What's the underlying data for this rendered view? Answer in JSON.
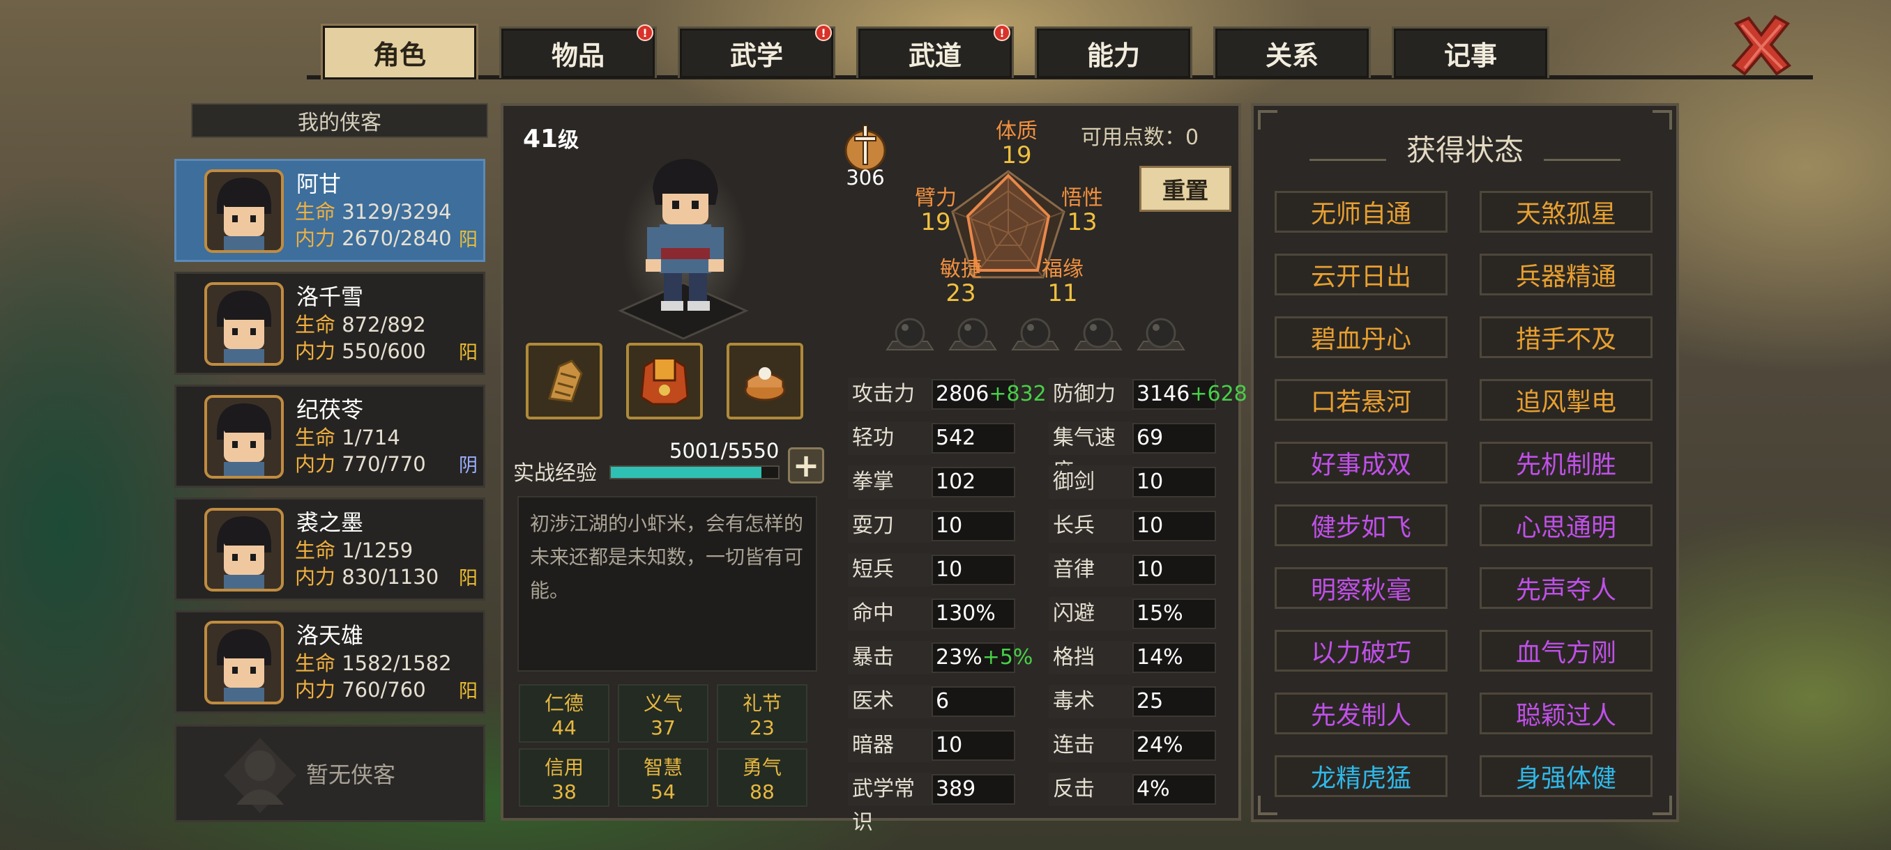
{
  "tabs": [
    {
      "label": "角色",
      "active": true,
      "badge": false
    },
    {
      "label": "物品",
      "active": false,
      "badge": true
    },
    {
      "label": "武学",
      "active": false,
      "badge": true
    },
    {
      "label": "武道",
      "active": false,
      "badge": true
    },
    {
      "label": "能力",
      "active": false,
      "badge": false
    },
    {
      "label": "关系",
      "active": false,
      "badge": false
    },
    {
      "label": "记事",
      "active": false,
      "badge": false
    }
  ],
  "badge_symbol": "!",
  "close_icon": "close-x-icon",
  "companions": {
    "header": "我的侠客",
    "hp_label": "生命",
    "mp_label": "内力",
    "list": [
      {
        "name": "阿甘",
        "hp": "3129/3294",
        "mp": "2670/2840",
        "align": "阳",
        "active": true
      },
      {
        "name": "洛千雪",
        "hp": "872/892",
        "mp": "550/600",
        "align": "阳",
        "active": false
      },
      {
        "name": "纪茯苓",
        "hp": "1/714",
        "mp": "770/770",
        "align": "阴",
        "active": false
      },
      {
        "name": "裘之墨",
        "hp": "1/1259",
        "mp": "830/1130",
        "align": "阳",
        "active": false
      },
      {
        "name": "洛天雄",
        "hp": "1582/1582",
        "mp": "760/760",
        "align": "阳",
        "active": false
      }
    ],
    "empty": "暂无侠客"
  },
  "character": {
    "level": "41",
    "level_suffix": "级",
    "weapon_value": "306",
    "attributes": {
      "constitution": {
        "label": "体质",
        "value": "19"
      },
      "strength": {
        "label": "臂力",
        "value": "19"
      },
      "insight": {
        "label": "悟性",
        "value": "13"
      },
      "agility": {
        "label": "敏捷",
        "value": "23"
      },
      "fortune": {
        "label": "福缘",
        "value": "11"
      }
    },
    "points_label": "可用点数：",
    "points": "0",
    "reset": "重置",
    "exp_label": "实战经验",
    "exp_value": "5001/5550",
    "exp_fraction": 0.901,
    "plus": "+",
    "description": "初涉江湖的小虾米，会有怎样的未来还都是未知数，一切皆有可能。",
    "virtues": [
      {
        "label": "仁德",
        "value": "44"
      },
      {
        "label": "义气",
        "value": "37"
      },
      {
        "label": "礼节",
        "value": "23"
      },
      {
        "label": "信用",
        "value": "38"
      },
      {
        "label": "智慧",
        "value": "54"
      },
      {
        "label": "勇气",
        "value": "88"
      }
    ],
    "stats_left": [
      {
        "label": "攻击力",
        "value": "2806",
        "bonus": "+832"
      },
      {
        "label": "轻功",
        "value": "542",
        "bonus": ""
      },
      {
        "label": "拳掌",
        "value": "102",
        "bonus": ""
      },
      {
        "label": "耍刀",
        "value": "10",
        "bonus": ""
      },
      {
        "label": "短兵",
        "value": "10",
        "bonus": ""
      },
      {
        "label": "命中",
        "value": "130%",
        "bonus": ""
      },
      {
        "label": "暴击",
        "value": "23%",
        "bonus": "+5%"
      },
      {
        "label": "医术",
        "value": "6",
        "bonus": ""
      },
      {
        "label": "暗器",
        "value": "10",
        "bonus": ""
      },
      {
        "label": "武学常识",
        "value": "389",
        "bonus": ""
      }
    ],
    "stats_right": [
      {
        "label": "防御力",
        "value": "3146",
        "bonus": "+628"
      },
      {
        "label": "集气速度",
        "value": "69",
        "bonus": ""
      },
      {
        "label": "御剑",
        "value": "10",
        "bonus": ""
      },
      {
        "label": "长兵",
        "value": "10",
        "bonus": ""
      },
      {
        "label": "音律",
        "value": "10",
        "bonus": ""
      },
      {
        "label": "闪避",
        "value": "15%",
        "bonus": ""
      },
      {
        "label": "格挡",
        "value": "14%",
        "bonus": ""
      },
      {
        "label": "毒术",
        "value": "25",
        "bonus": ""
      },
      {
        "label": "连击",
        "value": "24%",
        "bonus": ""
      },
      {
        "label": "反击",
        "value": "4%",
        "bonus": ""
      }
    ]
  },
  "statuses": {
    "title": "获得状态",
    "items": [
      {
        "label": "无师自通",
        "color": "#e8a030"
      },
      {
        "label": "天煞孤星",
        "color": "#e8a030"
      },
      {
        "label": "云开日出",
        "color": "#e8a030"
      },
      {
        "label": "兵器精通",
        "color": "#e8a030"
      },
      {
        "label": "碧血丹心",
        "color": "#e8a030"
      },
      {
        "label": "措手不及",
        "color": "#e8a030"
      },
      {
        "label": "口若悬河",
        "color": "#e8a030"
      },
      {
        "label": "追风掣电",
        "color": "#e8a030"
      },
      {
        "label": "好事成双",
        "color": "#c050e8"
      },
      {
        "label": "先机制胜",
        "color": "#c050e8"
      },
      {
        "label": "健步如飞",
        "color": "#c050e8"
      },
      {
        "label": "心思通明",
        "color": "#c050e8"
      },
      {
        "label": "明察秋毫",
        "color": "#c050e8"
      },
      {
        "label": "先声夺人",
        "color": "#c050e8"
      },
      {
        "label": "以力破巧",
        "color": "#c050e8"
      },
      {
        "label": "血气方刚",
        "color": "#c050e8"
      },
      {
        "label": "先发制人",
        "color": "#c050e8"
      },
      {
        "label": "聪颖过人",
        "color": "#c050e8"
      },
      {
        "label": "龙精虎猛",
        "color": "#30b8e8"
      },
      {
        "label": "身强体健",
        "color": "#30b8e8"
      }
    ]
  }
}
